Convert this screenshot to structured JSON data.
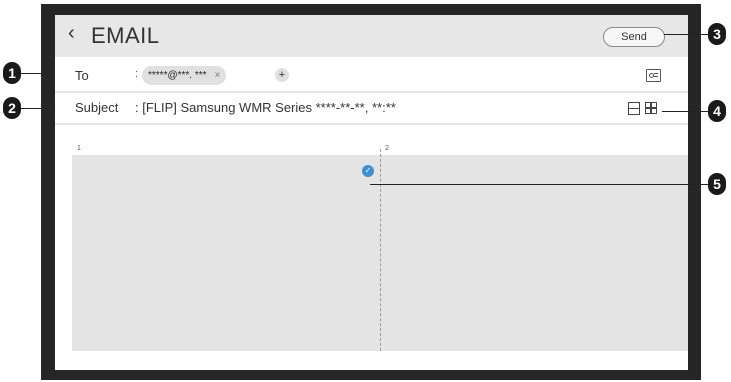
{
  "header": {
    "back_icon": "chevron-left-icon",
    "title": "EMAIL",
    "send_label": "Send"
  },
  "to_row": {
    "label": "To",
    "separator": ":",
    "recipient": "*****@***. ***",
    "remove_glyph": "×",
    "add_glyph": "+",
    "contact_icon": "contact-card-icon"
  },
  "subject_row": {
    "label": "Subject",
    "value": ": [FLIP] Samsung WMR Series ****-**-**, **:**",
    "layout_icons": [
      "single-layout-icon",
      "grid-layout-icon"
    ]
  },
  "canvas": {
    "page_labels": [
      "1",
      "2"
    ],
    "selected_check_icon": "check-circle-icon"
  },
  "callouts": [
    "1",
    "2",
    "3",
    "4",
    "5"
  ]
}
